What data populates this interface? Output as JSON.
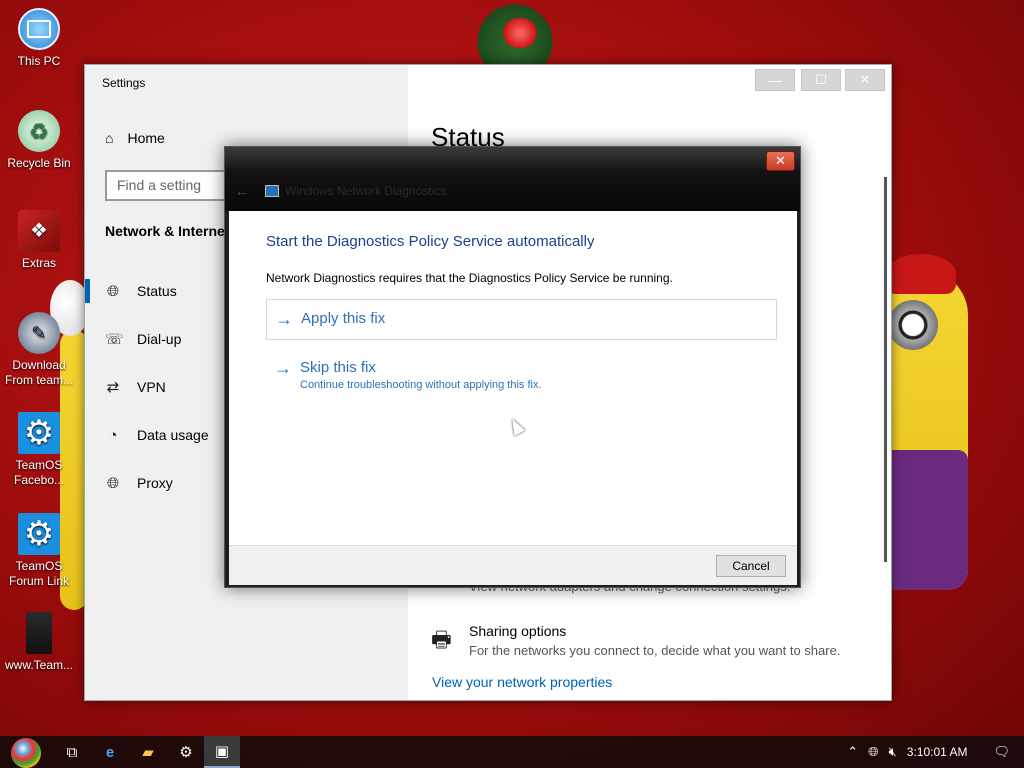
{
  "desktop": {
    "icons": [
      {
        "label": "This PC"
      },
      {
        "label": "Recycle Bin"
      },
      {
        "label": "Extras"
      },
      {
        "label": "Download From team..."
      },
      {
        "label": "TeamOS Facebo..."
      },
      {
        "label": "TeamOS Forum Link"
      },
      {
        "label": "www.Team..."
      }
    ]
  },
  "settings": {
    "app_title": "Settings",
    "home_label": "Home",
    "search_placeholder": "Find a setting",
    "section_title": "Network & Internet",
    "nav": [
      {
        "label": "Status",
        "icon": "globe-icon",
        "active": true
      },
      {
        "label": "Dial-up",
        "icon": "dialup-icon"
      },
      {
        "label": "VPN",
        "icon": "vpn-icon"
      },
      {
        "label": "Data usage",
        "icon": "data-usage-icon"
      },
      {
        "label": "Proxy",
        "icon": "globe-icon"
      }
    ],
    "page_title": "Status",
    "partial_text": "View network adapters and change connection settings.",
    "sharing": {
      "title": "Sharing options",
      "desc": "For the networks you connect to, decide what you want to share."
    },
    "view_link": "View your network properties"
  },
  "dialog": {
    "title": "Windows Network Diagnostics",
    "heading": "Start the Diagnostics Policy Service automatically",
    "description": "Network Diagnostics requires that the Diagnostics Policy Service be running.",
    "apply_label": "Apply this fix",
    "skip_label": "Skip this fix",
    "skip_sub": "Continue troubleshooting without applying this fix.",
    "cancel_label": "Cancel"
  },
  "taskbar": {
    "clock": "3:10:01 AM"
  },
  "colors": {
    "accent": "#0063b1",
    "link": "#2a71b7",
    "heading": "#1c3f8f",
    "nav_active_bar": "#0063b1"
  }
}
